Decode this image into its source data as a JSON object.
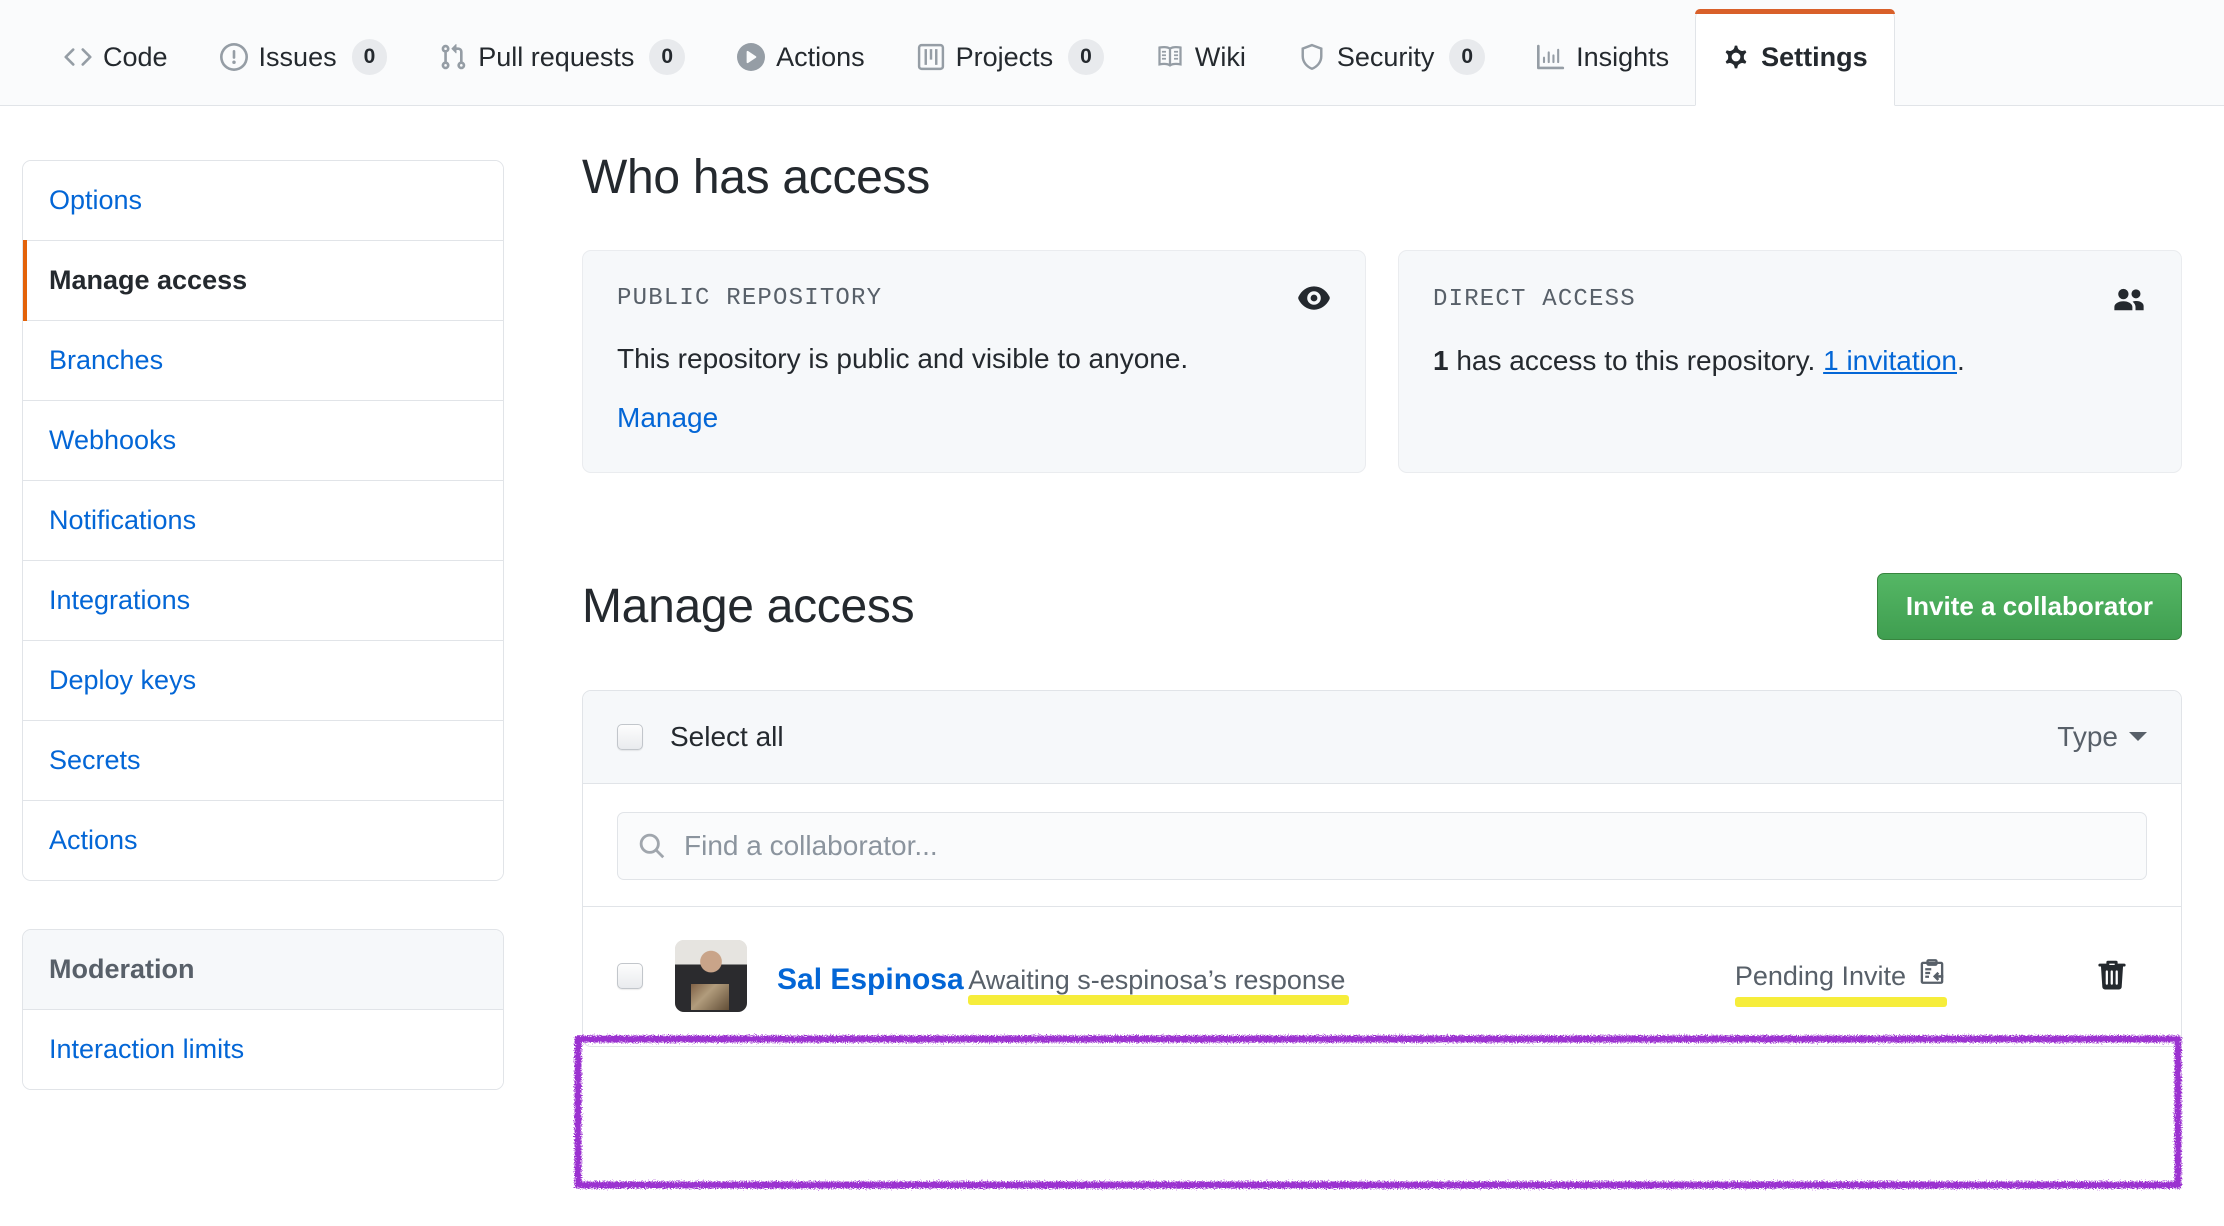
{
  "repo_nav": {
    "tabs": [
      {
        "label": "Code",
        "icon": "code-icon",
        "count": null,
        "active": false
      },
      {
        "label": "Issues",
        "icon": "issue-opened-icon",
        "count": "0",
        "active": false
      },
      {
        "label": "Pull requests",
        "icon": "git-pull-request-icon",
        "count": "0",
        "active": false
      },
      {
        "label": "Actions",
        "icon": "play-icon",
        "count": null,
        "active": false
      },
      {
        "label": "Projects",
        "icon": "project-icon",
        "count": "0",
        "active": false
      },
      {
        "label": "Wiki",
        "icon": "book-icon",
        "count": null,
        "active": false
      },
      {
        "label": "Security",
        "icon": "shield-icon",
        "count": "0",
        "active": false
      },
      {
        "label": "Insights",
        "icon": "graph-icon",
        "count": null,
        "active": false
      },
      {
        "label": "Settings",
        "icon": "gear-icon",
        "count": null,
        "active": true
      }
    ],
    "active_tab_accent": "#d9602a"
  },
  "sidebar": {
    "groups": [
      {
        "heading": null,
        "items": [
          {
            "label": "Options",
            "selected": false
          },
          {
            "label": "Manage access",
            "selected": true
          },
          {
            "label": "Branches",
            "selected": false
          },
          {
            "label": "Webhooks",
            "selected": false
          },
          {
            "label": "Notifications",
            "selected": false
          },
          {
            "label": "Integrations",
            "selected": false
          },
          {
            "label": "Deploy keys",
            "selected": false
          },
          {
            "label": "Secrets",
            "selected": false
          },
          {
            "label": "Actions",
            "selected": false
          }
        ]
      },
      {
        "heading": "Moderation",
        "items": [
          {
            "label": "Interaction limits",
            "selected": false
          }
        ]
      }
    ],
    "selected_accent": "#e36209"
  },
  "who_has_access": {
    "title": "Who has access",
    "cards": [
      {
        "label": "PUBLIC REPOSITORY",
        "icon": "eye-icon",
        "body_text": "This repository is public and visible to anyone.",
        "link_label": "Manage"
      },
      {
        "label": "DIRECT ACCESS",
        "icon": "people-icon",
        "body_count": "1",
        "body_text": " has access to this repository. ",
        "body_link": "1 invitation",
        "body_suffix": "."
      }
    ]
  },
  "manage_access": {
    "title": "Manage access",
    "invite_button": "Invite a collaborator",
    "invite_button_color": "#3f9e50",
    "select_all_label": "Select all",
    "type_filter_label": "Type",
    "search": {
      "placeholder": "Find a collaborator...",
      "value": "",
      "icon": "search-icon"
    },
    "collaborators": [
      {
        "name": "Sal Espinosa",
        "subtitle": "Awaiting s-espinosa’s response",
        "status": "Pending Invite",
        "status_icon": "pending-invite-icon",
        "avatar": "user-avatar",
        "delete_icon": "trash-icon",
        "highlighted": true
      }
    ]
  },
  "annotations": {
    "box_color": "#9b30d0",
    "highlight_color": "#f5ec2a"
  }
}
